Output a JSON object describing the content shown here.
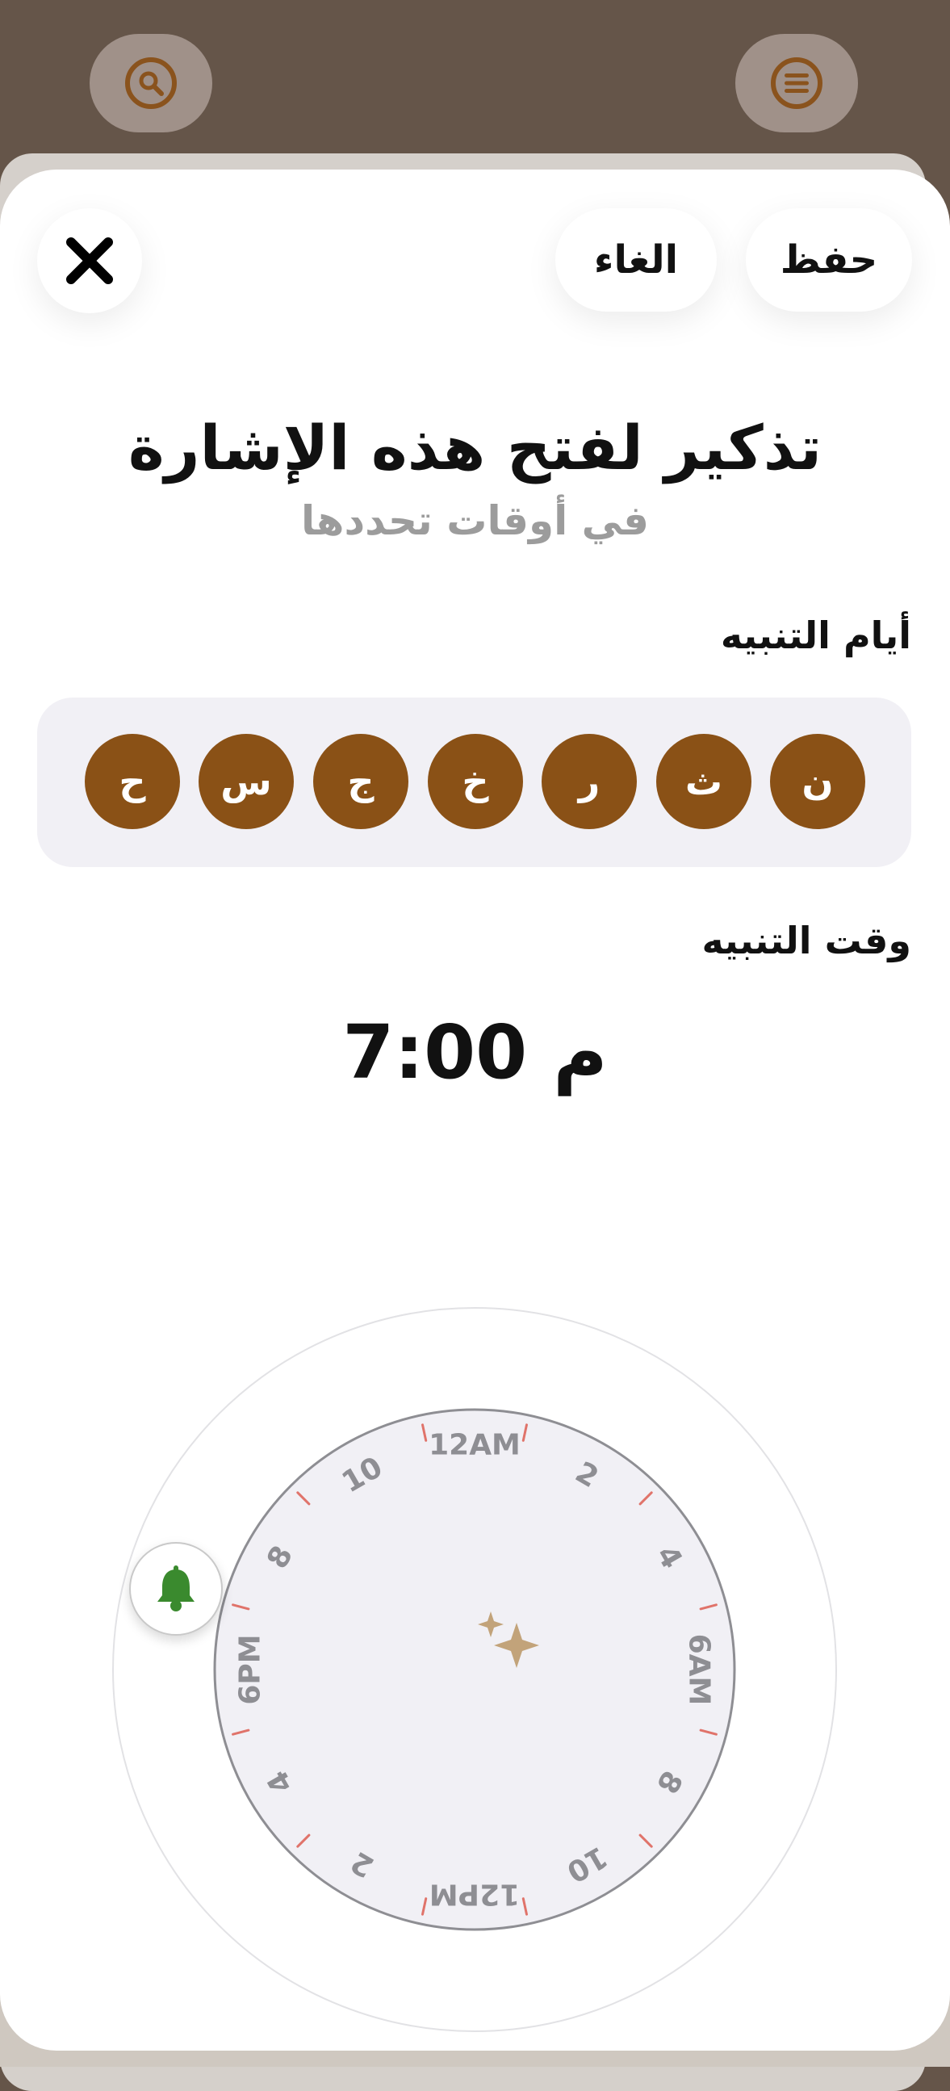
{
  "topbar": {
    "search_icon": "search-icon",
    "menu_icon": "menu-icon"
  },
  "header": {
    "save_label": "حفظ",
    "cancel_label": "الغاء",
    "close_icon": "close-icon"
  },
  "title": "تذكير لفتح هذه الإشارة",
  "subtitle": "في أوقات تحددها",
  "days_section": {
    "label": "أيام التنبيه",
    "days": [
      "ح",
      "س",
      "ج",
      "خ",
      "ر",
      "ث",
      "ن"
    ]
  },
  "time_section": {
    "label": "وقت التنبيه",
    "time_value": "7:00",
    "period": "م"
  },
  "dial": {
    "hour_labels": [
      "12AM",
      "2",
      "4",
      "6AM",
      "8",
      "10",
      "12PM",
      "2",
      "4",
      "6PM",
      "8",
      "10"
    ],
    "center_icon": "moon-stars-icon",
    "handle_icon": "bell-icon",
    "accent_color": "#8a5116",
    "bell_color": "#3a8a2e"
  }
}
